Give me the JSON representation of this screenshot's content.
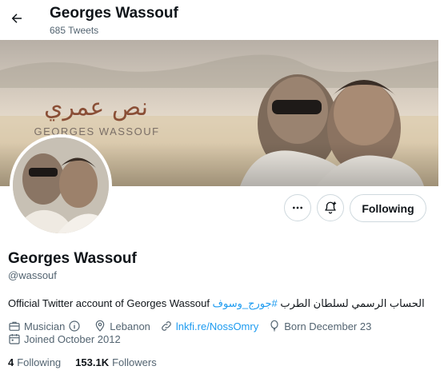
{
  "header": {
    "title": "Georges Wassouf",
    "tweet_count": "685 Tweets"
  },
  "banner": {
    "arabic_title": "نص عمري",
    "caption": "GEORGES WASSOUF"
  },
  "actions": {
    "more_icon": "more-horizontal-icon",
    "notify_icon": "bell-plus-icon",
    "following_label": "Following"
  },
  "profile": {
    "name": "Georges Wassouf",
    "handle": "@wassouf",
    "bio_text": "Official Twitter account of Georges Wassouf الحساب الرسمي لسلطان الطرب",
    "bio_hashtag": "#جورج_وسوف",
    "category": "Musician",
    "location": "Lebanon",
    "website": "lnkfi.re/NossOmry",
    "born": "Born December 23",
    "joined": "Joined October 2012"
  },
  "stats": {
    "following_count": "4",
    "following_label": "Following",
    "followers_count": "153.1K",
    "followers_label": "Followers"
  },
  "colors": {
    "accent": "#1d9bf0",
    "secondary_text": "#536471",
    "border": "#cfd9de"
  }
}
